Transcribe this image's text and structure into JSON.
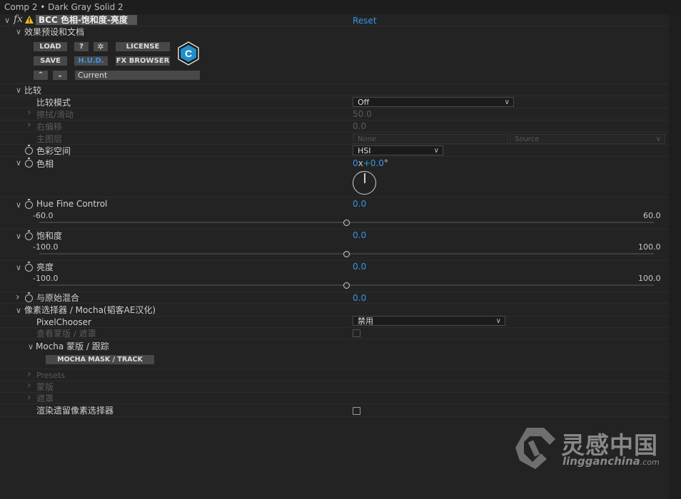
{
  "window": {
    "title": "Comp 2 • Dark Gray Solid 2"
  },
  "effect": {
    "fx": "fx",
    "name": "BCC 色相-饱和度-亮度",
    "reset": "Reset"
  },
  "presets": {
    "group": "效果预设和文档",
    "load": "LOAD",
    "help": "?",
    "license": "LICENSE",
    "save": "SAVE",
    "hud": "H.U.D.",
    "fx_browser": "FX BROWSER",
    "current": "Current",
    "logo_letter": "C"
  },
  "compare": {
    "group": "比较",
    "mode_label": "比较模式",
    "mode_value": "Off",
    "wipe_label": "擦拭/滑动",
    "wipe_value": "50.0",
    "offset_label": "右偏移",
    "offset_value": "0.0",
    "main_layer_label": "主图层",
    "main_layer_value": "None",
    "source_value": "Source"
  },
  "colorspace": {
    "label": "色彩空间",
    "value": "HSI"
  },
  "hue": {
    "label": "色相",
    "rev": "0",
    "x": "x",
    "deg": "+0.0",
    "unit": "°"
  },
  "hue_fine": {
    "label": "Hue Fine Control",
    "value": "0.0",
    "min": "-60.0",
    "max": "60.0",
    "pos": 0.5
  },
  "saturation": {
    "label": "饱和度",
    "value": "0.0",
    "min": "-100.0",
    "max": "100.0",
    "pos": 0.5
  },
  "lightness": {
    "label": "亮度",
    "value": "0.0",
    "min": "-100.0",
    "max": "100.0",
    "pos": 0.5
  },
  "mix": {
    "label": "与原始混合",
    "value": "0.0"
  },
  "pixel_chooser": {
    "group": "像素选择器 / Mocha(韬客AE汉化)",
    "chooser_label": "PixelChooser",
    "chooser_value": "禁用",
    "view_mask_label": "查看蒙版 / 遮罩",
    "mocha_group": "Mocha 蒙版 / 跟踪",
    "mocha_button": "MOCHA MASK / TRACK",
    "presets_label": "Presets",
    "mask_label": "蒙版",
    "matte_label": "遮罩",
    "render_label": "渲染遗留像素选择器"
  },
  "watermark": {
    "brand": "灵感中国",
    "url": "lingganchina",
    "tld": ".com"
  }
}
